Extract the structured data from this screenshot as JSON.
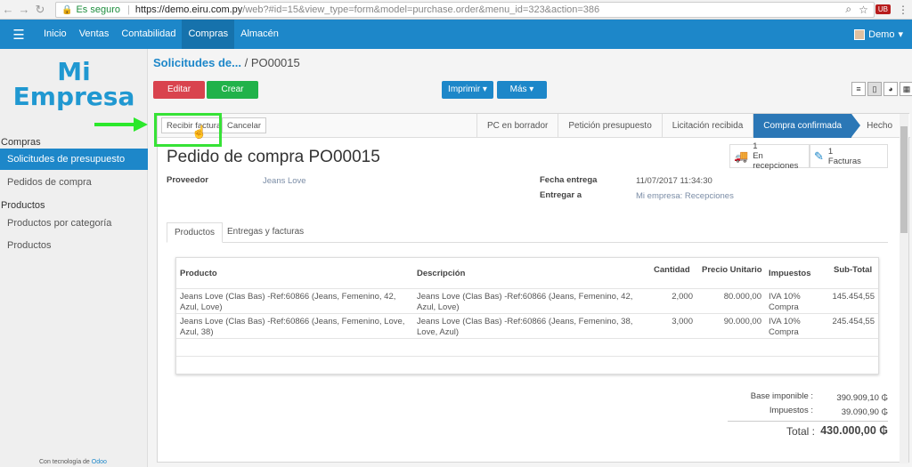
{
  "browser": {
    "secure_label": "Es seguro",
    "url_host": "https://demo.eiru.com.py",
    "url_rest": "/web?#id=15&view_type=form&model=purchase.order&menu_id=323&action=386"
  },
  "topbar": {
    "menu": [
      "Inicio",
      "Ventas",
      "Contabilidad",
      "Compras",
      "Almacén"
    ],
    "active": "Compras",
    "user": "Demo",
    "color": "#1d87c9"
  },
  "sidebar": {
    "logo_line1": "Mi",
    "logo_line2": "Empresa",
    "section_compras": "Compras",
    "compras_items": [
      "Solicitudes de presupuesto",
      "Pedidos de compra"
    ],
    "section_productos": "Productos",
    "productos_items": [
      "Productos por categoría",
      "Productos"
    ],
    "powered_prefix": "Con tecnología de",
    "powered_brand": "Odoo"
  },
  "breadcrumb": {
    "parent": "Solicitudes de...",
    "current": "/ PO00015"
  },
  "buttons": {
    "edit": "Editar",
    "create": "Crear",
    "print": "Imprimir ▾",
    "more": "Más ▾",
    "receive_invoice": "Recibir factura",
    "cancel": "Cancelar"
  },
  "stages": [
    "PC en borrador",
    "Petición presupuesto",
    "Licitación recibida",
    "Compra confirmada",
    "Hecho"
  ],
  "active_stage": "Compra confirmada",
  "smart_buttons": [
    {
      "count": "1",
      "label": "En recepciones",
      "icon": "truck-icon"
    },
    {
      "count": "1",
      "label": "Facturas",
      "icon": "edit-icon"
    }
  ],
  "form": {
    "title": "Pedido de compra PO00015",
    "proveedor_label": "Proveedor",
    "proveedor": "Jeans Love",
    "fecha_label": "Fecha entrega",
    "fecha": "11/07/2017 11:34:30",
    "entregar_label": "Entregar a",
    "entregar": "Mi empresa: Recepciones"
  },
  "tabs": [
    "Productos",
    "Entregas y facturas"
  ],
  "table": {
    "headers": [
      "Producto",
      "Descripción",
      "Cantidad",
      "Precio Unitario",
      "Impuestos",
      "Sub-Total"
    ],
    "rows": [
      {
        "producto": "Jeans Love (Clas Bas) -Ref:60866 (Jeans, Femenino, 42, Azul, Love)",
        "descripcion": "Jeans Love (Clas Bas) -Ref:60866 (Jeans, Femenino, 42, Azul, Love)",
        "cantidad": "2,000",
        "precio": "80.000,00",
        "impuestos": "IVA 10% Compra",
        "subtotal": "145.454,55"
      },
      {
        "producto": "Jeans Love (Clas Bas) -Ref:60866 (Jeans, Femenino, Love, Azul, 38)",
        "descripcion": "Jeans Love (Clas Bas) -Ref:60866 (Jeans, Femenino, 38, Love, Azul)",
        "cantidad": "3,000",
        "precio": "90.000,00",
        "impuestos": "IVA 10% Compra",
        "subtotal": "245.454,55"
      }
    ]
  },
  "totals": {
    "base_label": "Base imponible :",
    "base": "390.909,10 ₲",
    "imp_label": "Impuestos :",
    "imp": "39.090,90 ₲",
    "total_label": "Total :",
    "total": "430.000,00 ₲"
  }
}
